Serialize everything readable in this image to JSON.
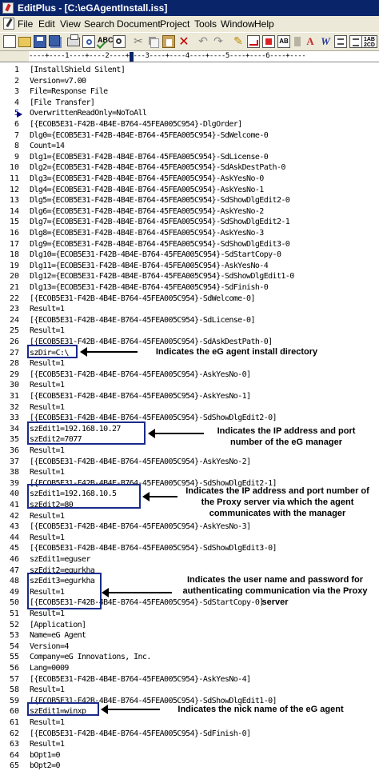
{
  "window": {
    "title": "EditPlus - [C:\\eGAgentInstall.iss]"
  },
  "menu": [
    "File",
    "Edit",
    "View",
    "Search",
    "Document",
    "Project",
    "Tools",
    "Window",
    "Help"
  ],
  "toolbar": {
    "icons": [
      "new-file-icon",
      "open-folder-icon",
      "save-icon",
      "save-all-icon",
      "print-icon",
      "print-preview-icon",
      "spell-check-icon",
      "find-icon",
      "cut-icon",
      "copy-icon",
      "paste-icon",
      "delete-icon",
      "undo-icon",
      "redo-icon",
      "marker-icon",
      "word-wrap-icon",
      "hex-view-icon",
      "ruler-icon",
      "font-icon",
      "word-wrap-toggle-icon",
      "line-number-icon",
      "list-icon",
      "column-number-icon"
    ],
    "spell_label": "ABC",
    "ruler_label": "AB",
    "colnum_label": "1AB 2CD",
    "font_label": "A",
    "ww_label": "W"
  },
  "ruler": {
    "text": "----+----1----+----2----+----3----+----4----+----5----+----6----+----"
  },
  "editor": {
    "lines": [
      {
        "n": "1",
        "text": "[InstallShield Silent]"
      },
      {
        "n": "2",
        "text": "Version=v7.00"
      },
      {
        "n": "3",
        "text": "File=Response File"
      },
      {
        "n": "4",
        "text": "[File Transfer]"
      },
      {
        "n": "5",
        "text": "OverwrittenReadOnly=NoToAll"
      },
      {
        "n": "6",
        "text": "[{ECOB5E31-F42B-4B4E-B764-45FEA005C954}-DlgOrder]"
      },
      {
        "n": "7",
        "text": "Dlg0={ECOB5E31-F42B-4B4E-B764-45FEA005C954}-SdWelcome-0"
      },
      {
        "n": "8",
        "text": "Count=14"
      },
      {
        "n": "9",
        "text": "Dlg1={ECOB5E31-F42B-4B4E-B764-45FEA005C954}-SdLicense-0"
      },
      {
        "n": "10",
        "text": "Dlg2={ECOB5E31-F42B-4B4E-B764-45FEA005C954}-SdAskDestPath-0"
      },
      {
        "n": "11",
        "text": "Dlg3={ECOB5E31-F42B-4B4E-B764-45FEA005C954}-AskYesNo-0"
      },
      {
        "n": "12",
        "text": "Dlg4={ECOB5E31-F42B-4B4E-B764-45FEA005C954}-AskYesNo-1"
      },
      {
        "n": "13",
        "text": "Dlg5={ECOB5E31-F42B-4B4E-B764-45FEA005C954}-SdShowDlgEdit2-0"
      },
      {
        "n": "14",
        "text": "Dlg6={ECOB5E31-F42B-4B4E-B764-45FEA005C954}-AskYesNo-2"
      },
      {
        "n": "15",
        "text": "Dlg7={ECOB5E31-F42B-4B4E-B764-45FEA005C954}-SdShowDlgEdit2-1"
      },
      {
        "n": "16",
        "text": "Dlg8={ECOB5E31-F42B-4B4E-B764-45FEA005C954}-AskYesNo-3"
      },
      {
        "n": "17",
        "text": "Dlg9={ECOB5E31-F42B-4B4E-B764-45FEA005C954}-SdShowDlgEdit3-0"
      },
      {
        "n": "18",
        "text": "Dlg10={ECOB5E31-F42B-4B4E-B764-45FEA005C954}-SdStartCopy-0"
      },
      {
        "n": "19",
        "text": "Dlg11={ECOB5E31-F42B-4B4E-B764-45FEA005C954}-AskYesNo-4"
      },
      {
        "n": "20",
        "text": "Dlg12={ECOB5E31-F42B-4B4E-B764-45FEA005C954}-SdShowDlgEdit1-0"
      },
      {
        "n": "21",
        "text": "Dlg13={ECOB5E31-F42B-4B4E-B764-45FEA005C954}-SdFinish-0"
      },
      {
        "n": "22",
        "text": "[{ECOB5E31-F42B-4B4E-B764-45FEA005C954}-SdWelcome-0]"
      },
      {
        "n": "23",
        "text": "Result=1"
      },
      {
        "n": "24",
        "text": "[{ECOB5E31-F42B-4B4E-B764-45FEA005C954}-SdLicense-0]"
      },
      {
        "n": "25",
        "text": "Result=1"
      },
      {
        "n": "26",
        "text": "[{ECOB5E31-F42B-4B4E-B764-45FEA005C954}-SdAskDestPath-0]"
      },
      {
        "n": "27",
        "text": "szDir=C:\\"
      },
      {
        "n": "28",
        "text": "Result=1"
      },
      {
        "n": "29",
        "text": "[{ECOB5E31-F42B-4B4E-B764-45FEA005C954}-AskYesNo-0]"
      },
      {
        "n": "30",
        "text": "Result=1"
      },
      {
        "n": "31",
        "text": "[{ECOB5E31-F42B-4B4E-B764-45FEA005C954}-AskYesNo-1]"
      },
      {
        "n": "32",
        "text": "Result=1"
      },
      {
        "n": "33",
        "text": "[{ECOB5E31-F42B-4B4E-B764-45FEA005C954}-SdShowDlgEdit2-0]"
      },
      {
        "n": "34",
        "text": "szEdit1=192.168.10.27"
      },
      {
        "n": "35",
        "text": "szEdit2=7077"
      },
      {
        "n": "36",
        "text": "Result=1"
      },
      {
        "n": "37",
        "text": "[{ECOB5E31-F42B-4B4E-B764-45FEA005C954}-AskYesNo-2]"
      },
      {
        "n": "38",
        "text": "Result=1"
      },
      {
        "n": "39",
        "text": "[{ECOB5E31-F42B-4B4E-B764-45FEA005C954}-SdShowDlgEdit2-1]"
      },
      {
        "n": "40",
        "text": "szEdit1=192.168.10.5"
      },
      {
        "n": "41",
        "text": "szEdit2=80"
      },
      {
        "n": "42",
        "text": "Result=1"
      },
      {
        "n": "43",
        "text": "[{ECOB5E31-F42B-4B4E-B764-45FEA005C954}-AskYesNo-3]"
      },
      {
        "n": "44",
        "text": "Result=1"
      },
      {
        "n": "45",
        "text": "[{ECOB5E31-F42B-4B4E-B764-45FEA005C954}-SdShowDlgEdit3-0]"
      },
      {
        "n": "46",
        "text": "szEdit1=eguser"
      },
      {
        "n": "47",
        "text": "szEdit2=egurkha"
      },
      {
        "n": "48",
        "text": "szEdit3=egurkha"
      },
      {
        "n": "49",
        "text": "Result=1"
      },
      {
        "n": "50",
        "text": "[{ECOB5E31-F42B-4B4E-B764-45FEA005C954}-SdStartCopy-0]"
      },
      {
        "n": "51",
        "text": "Result=1"
      },
      {
        "n": "52",
        "text": "[Application]"
      },
      {
        "n": "53",
        "text": "Name=eG Agent"
      },
      {
        "n": "54",
        "text": "Version=4"
      },
      {
        "n": "55",
        "text": "Company=eG Innovations, Inc."
      },
      {
        "n": "56",
        "text": "Lang=0009"
      },
      {
        "n": "57",
        "text": "[{ECOB5E31-F42B-4B4E-B764-45FEA005C954}-AskYesNo-4]"
      },
      {
        "n": "58",
        "text": "Result=1"
      },
      {
        "n": "59",
        "text": "[{ECOB5E31-F42B-4B4E-B764-45FEA005C954}-SdShowDlgEdit1-0]"
      },
      {
        "n": "60",
        "text": "szEdit1=winxp"
      },
      {
        "n": "61",
        "text": "Result=1"
      },
      {
        "n": "62",
        "text": "[{ECOB5E31-F42B-4B4E-B764-45FEA005C954}-SdFinish-0]"
      },
      {
        "n": "63",
        "text": "Result=1"
      },
      {
        "n": "64",
        "text": "bOpt1=0"
      },
      {
        "n": "65",
        "text": "bOpt2=0"
      }
    ]
  },
  "annotations": [
    {
      "text": "Indicates the eG agent install directory"
    },
    {
      "text": "Indicates the IP address and port number of the eG manager"
    },
    {
      "text": "Indicates the IP address and port number of the Proxy server via which the agent communicates with the manager"
    },
    {
      "text": "Indicates the user name and password for authenticating communication via the Proxy server"
    },
    {
      "text": "Indicates the nick name of the eG agent"
    }
  ]
}
